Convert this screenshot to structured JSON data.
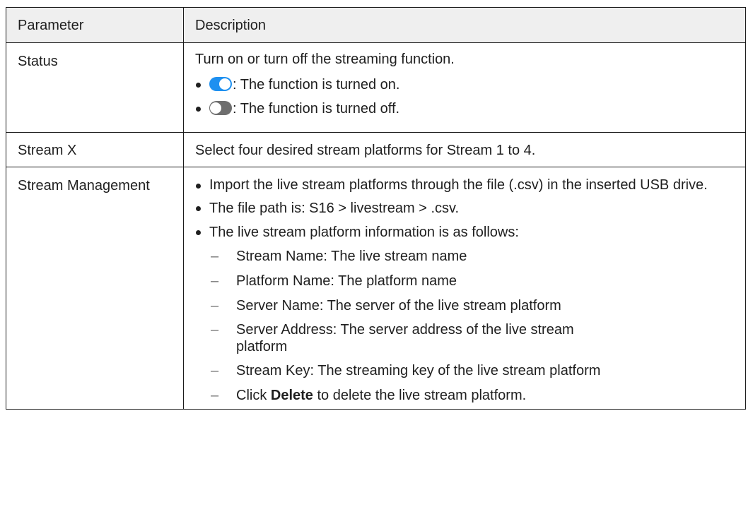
{
  "table": {
    "headers": {
      "parameter": "Parameter",
      "description": "Description"
    },
    "status": {
      "param": "Status",
      "intro": "Turn on or turn off the streaming function.",
      "on_text": ": The function is turned on.",
      "off_text": ": The function is turned off."
    },
    "stream_x": {
      "param": "Stream X",
      "desc": "Select four desired stream platforms for Stream 1 to 4."
    },
    "stream_mgmt": {
      "param": "Stream Management",
      "bullets": [
        "Import the live stream platforms through the file (.csv) in the inserted USB drive.",
        "The file path is: S16 > livestream > .csv.",
        "The live stream platform information is as follows:"
      ],
      "dash": "–",
      "sub_items": [
        "Stream Name: The live stream name",
        "Platform Name: The platform name",
        "Server Name: The server of the live stream platform",
        "Server Address: The server address of the live stream platform",
        "Stream Key: The streaming key of the live stream platform"
      ],
      "delete_prefix": "Click ",
      "delete_bold": "Delete",
      "delete_suffix": " to delete the live stream platform."
    }
  },
  "colors": {
    "toggle_on": "#1e90f0",
    "toggle_off": "#6e6e6e",
    "header_bg": "#efefef"
  },
  "icons": {
    "toggle_on": "toggle-on-icon",
    "toggle_off": "toggle-off-icon"
  }
}
